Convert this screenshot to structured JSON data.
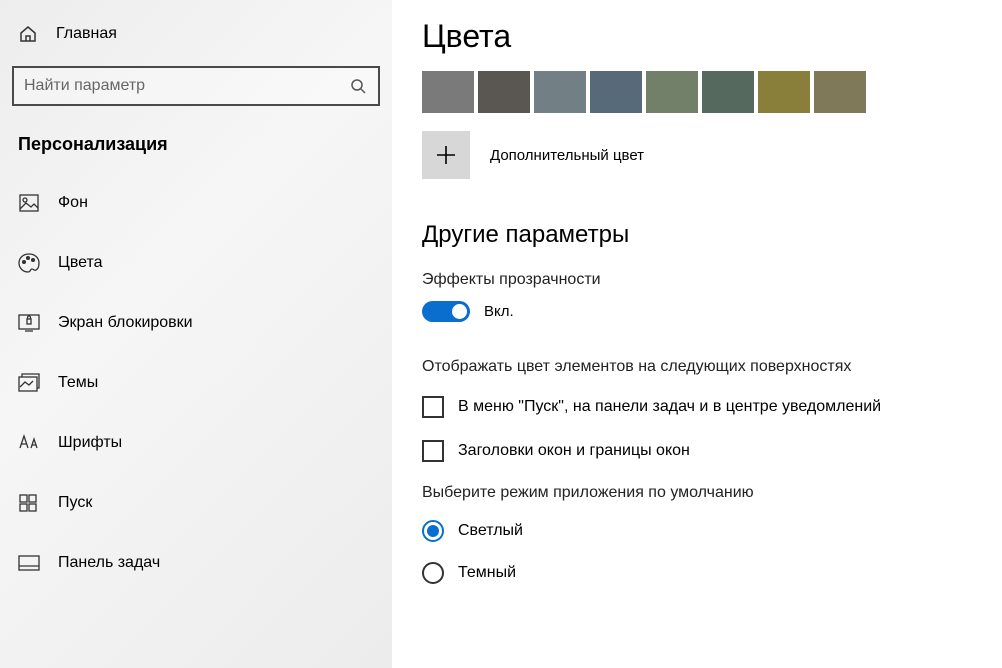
{
  "sidebar": {
    "home": "Главная",
    "search_placeholder": "Найти параметр",
    "section": "Персонализация",
    "items": [
      {
        "label": "Фон"
      },
      {
        "label": "Цвета"
      },
      {
        "label": "Экран блокировки"
      },
      {
        "label": "Темы"
      },
      {
        "label": "Шрифты"
      },
      {
        "label": "Пуск"
      },
      {
        "label": "Панель задач"
      }
    ]
  },
  "main": {
    "title": "Цвета",
    "swatches": [
      "#7a7a7a",
      "#5a5753",
      "#728086",
      "#576a7a",
      "#72806a",
      "#55695f",
      "#8a7f3a",
      "#7f7859"
    ],
    "custom_color": "Дополнительный цвет",
    "other_h2": "Другие параметры",
    "transparency_label": "Эффекты прозрачности",
    "toggle_state": "Вкл.",
    "surface_label": "Отображать цвет элементов на следующих поверхностях",
    "check1": "В меню \"Пуск\", на панели задач и в центре уведомлений",
    "check2": "Заголовки окон и границы окон",
    "mode_label": "Выберите режим приложения по умолчанию",
    "mode_light": "Светлый",
    "mode_dark": "Темный"
  }
}
